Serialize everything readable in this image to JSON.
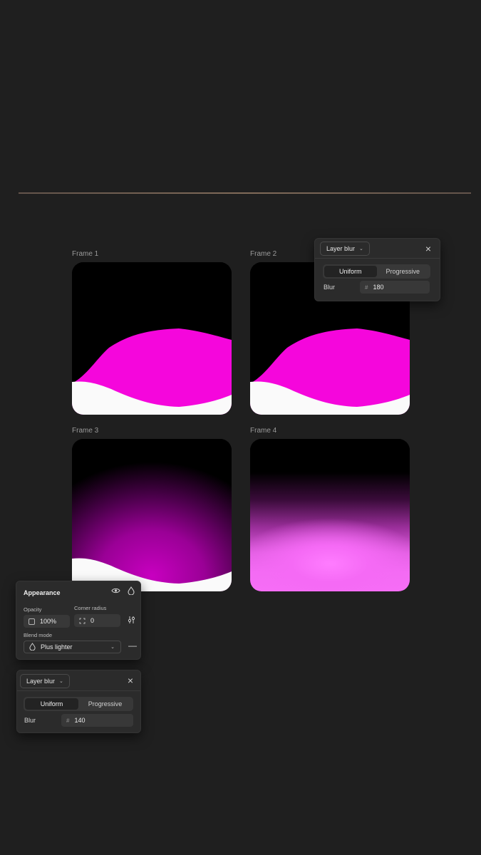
{
  "frames": [
    {
      "label": "Frame 1"
    },
    {
      "label": "Frame 2"
    },
    {
      "label": "Frame 3"
    },
    {
      "label": "Frame 4"
    }
  ],
  "blur_panel_top": {
    "dropdown_label": "Layer blur",
    "tabs": [
      "Uniform",
      "Progressive"
    ],
    "active_tab": "Uniform",
    "blur_label": "Blur",
    "blur_value": "180"
  },
  "appearance_panel": {
    "title": "Appearance",
    "opacity_label": "Opacity",
    "opacity_value": "100%",
    "corner_radius_label": "Corner radius",
    "corner_radius_value": "0",
    "blend_mode_label": "Blend mode",
    "blend_mode_value": "Plus lighter"
  },
  "blur_panel_bottom": {
    "dropdown_label": "Layer blur",
    "tabs": [
      "Uniform",
      "Progressive"
    ],
    "active_tab": "Uniform",
    "blur_label": "Blur",
    "blur_value": "140"
  },
  "colors": {
    "background": "#1f1f1f",
    "magenta": "#f506dc",
    "panel": "#2b2b2b"
  }
}
